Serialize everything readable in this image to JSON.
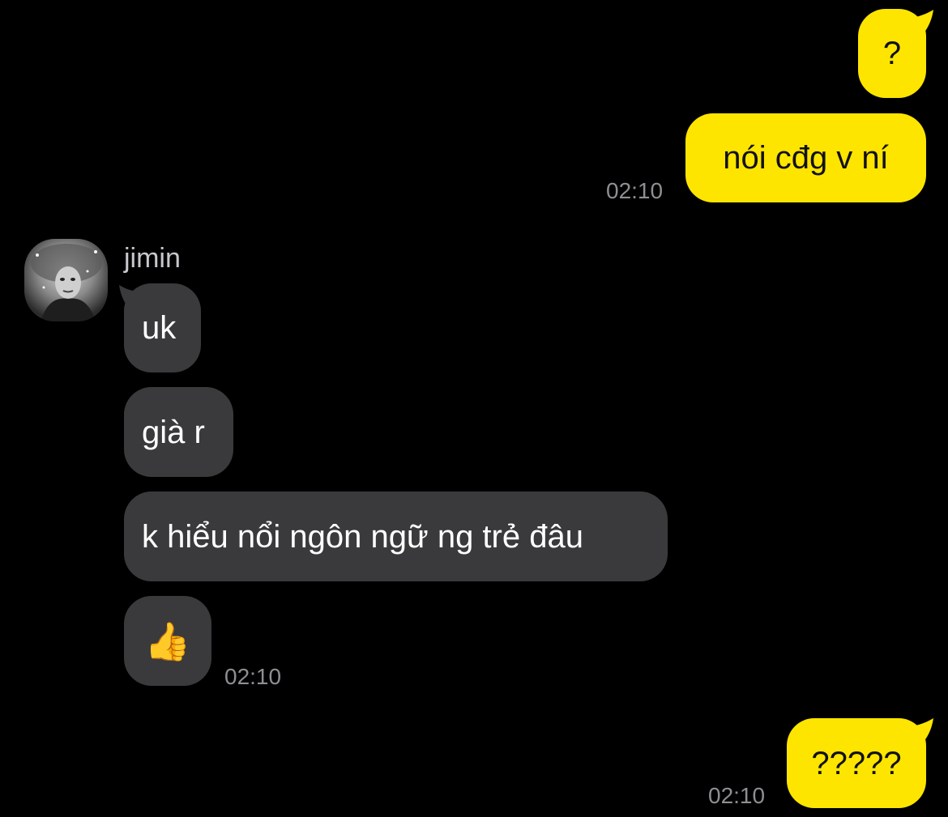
{
  "chat": {
    "sender_name": "jimin",
    "messages": [
      {
        "id": "out-1",
        "direction": "outgoing",
        "text": "?"
      },
      {
        "id": "out-2",
        "direction": "outgoing",
        "text": "nói cđg v ní",
        "time": "02:10"
      },
      {
        "id": "in-1",
        "direction": "incoming",
        "text": "uk"
      },
      {
        "id": "in-2",
        "direction": "incoming",
        "text": "già r"
      },
      {
        "id": "in-3",
        "direction": "incoming",
        "text": "k hiểu nổi ngôn ngữ ng trẻ đâu"
      },
      {
        "id": "in-4",
        "direction": "incoming",
        "text": "👍",
        "time": "02:10"
      },
      {
        "id": "out-3",
        "direction": "outgoing",
        "text": "?????",
        "time": "02:10"
      }
    ]
  },
  "colors": {
    "background": "#000000",
    "outgoing_bubble": "#FEE500",
    "incoming_bubble": "#3A3A3C",
    "timestamp": "#8E8E93"
  },
  "icons": {
    "avatar": "profile-photo",
    "thumbs_up": "thumbs-up-emoji"
  }
}
